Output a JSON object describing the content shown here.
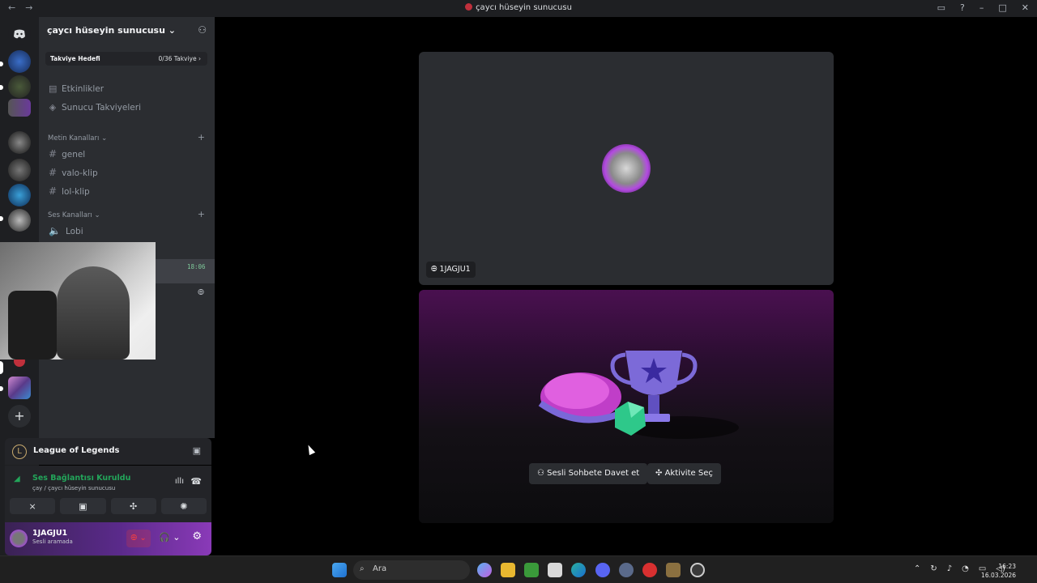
{
  "window": {
    "title": "çaycı hüseyin sunucusu",
    "back_icon": "←",
    "forward_icon": "→"
  },
  "server": {
    "name": "çaycı hüseyin sunucusu ⌄",
    "boost_goal_label": "Takviye Hedefi",
    "boost_progress": "0/36 Takviye ›",
    "menu": [
      {
        "label": "Etkinlikler",
        "icon": "calendar-icon"
      },
      {
        "label": "Sunucu Takviyeleri",
        "icon": "boost-icon"
      }
    ],
    "text_category": "Metin Kanalları ⌄",
    "text_channels": [
      "genel",
      "valo-klip",
      "lol-klip"
    ],
    "voice_category": "Ses Kanalları ⌄",
    "voice_channels": [
      "Lobi"
    ],
    "voice_timer": "18:06"
  },
  "panel": {
    "activity_name": "League of Legends",
    "connection_status": "Ses Bağlantısı Kuruldu",
    "connection_location": "çay / çaycı hüseyin sunucusu",
    "user_name": "1JAGJU1",
    "user_status": "Sesli aramada"
  },
  "stage": {
    "participant_tag": "1JAGJU1",
    "invite_button": "Sesli Sohbete Davet et",
    "activity_button": "Aktivite Seç"
  },
  "taskbar": {
    "search_placeholder": "Ara",
    "time": "16:23",
    "date": "16.03.2026"
  },
  "colors": {
    "accent_green": "#23a55a",
    "danger_red": "#f23f43",
    "sidebar_bg": "#2b2d31",
    "rail_bg": "#1e1f22"
  }
}
